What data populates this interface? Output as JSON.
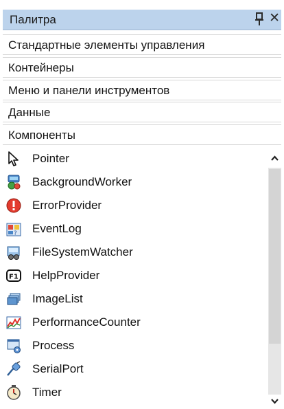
{
  "panel": {
    "title": "Палитра",
    "close": "✕"
  },
  "categories": [
    "Стандартные элементы управления",
    "Контейнеры",
    "Меню и панели инструментов",
    "Данные",
    "Компоненты"
  ],
  "items": [
    {
      "label": "Pointer",
      "icon": "pointer-icon"
    },
    {
      "label": "BackgroundWorker",
      "icon": "background-worker-icon"
    },
    {
      "label": "ErrorProvider",
      "icon": "error-provider-icon"
    },
    {
      "label": "EventLog",
      "icon": "event-log-icon"
    },
    {
      "label": "FileSystemWatcher",
      "icon": "file-system-watcher-icon"
    },
    {
      "label": "HelpProvider",
      "icon": "help-provider-icon"
    },
    {
      "label": "ImageList",
      "icon": "image-list-icon"
    },
    {
      "label": "PerformanceCounter",
      "icon": "performance-counter-icon"
    },
    {
      "label": "Process",
      "icon": "process-icon"
    },
    {
      "label": "SerialPort",
      "icon": "serial-port-icon"
    },
    {
      "label": "Timer",
      "icon": "timer-icon"
    }
  ],
  "colors": {
    "header": "#bcd3ec",
    "scroll_track": "#e6e6e6",
    "scroll_thumb": "#d4d4d4"
  }
}
